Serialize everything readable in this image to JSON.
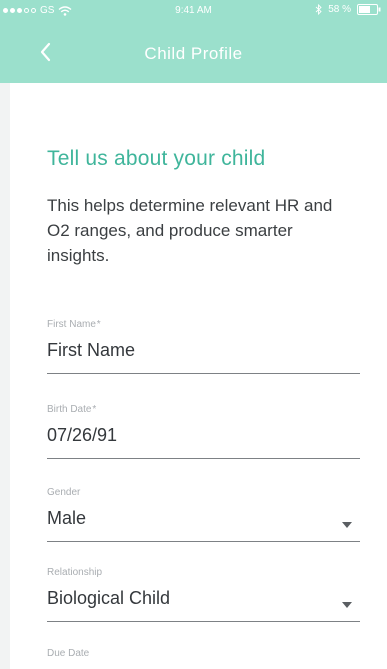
{
  "status_bar": {
    "carrier": "GS",
    "time": "9:41 AM",
    "battery": "58 %"
  },
  "nav": {
    "back_icon": "chevron-left-icon",
    "title": "Child Profile"
  },
  "form": {
    "heading": "Tell us about your child",
    "intro": "This helps determine relevant HR and O2 ranges, and produce smarter insights.",
    "fields": [
      {
        "label": "First Name",
        "required": "*",
        "value": "First Name",
        "type": "text"
      },
      {
        "label": "Birth Date",
        "required": "*",
        "value": "07/26/91",
        "type": "text"
      },
      {
        "label": "Gender",
        "required": "",
        "value": "Male",
        "type": "select"
      },
      {
        "label": "Relationship",
        "required": "",
        "value": "Biological Child",
        "type": "select"
      },
      {
        "label": "Due Date",
        "required": "",
        "value": "",
        "type": "text"
      }
    ]
  },
  "colors": {
    "header": "#9be0cc",
    "accent": "#3fb59b",
    "background": "#f2f3f3"
  }
}
